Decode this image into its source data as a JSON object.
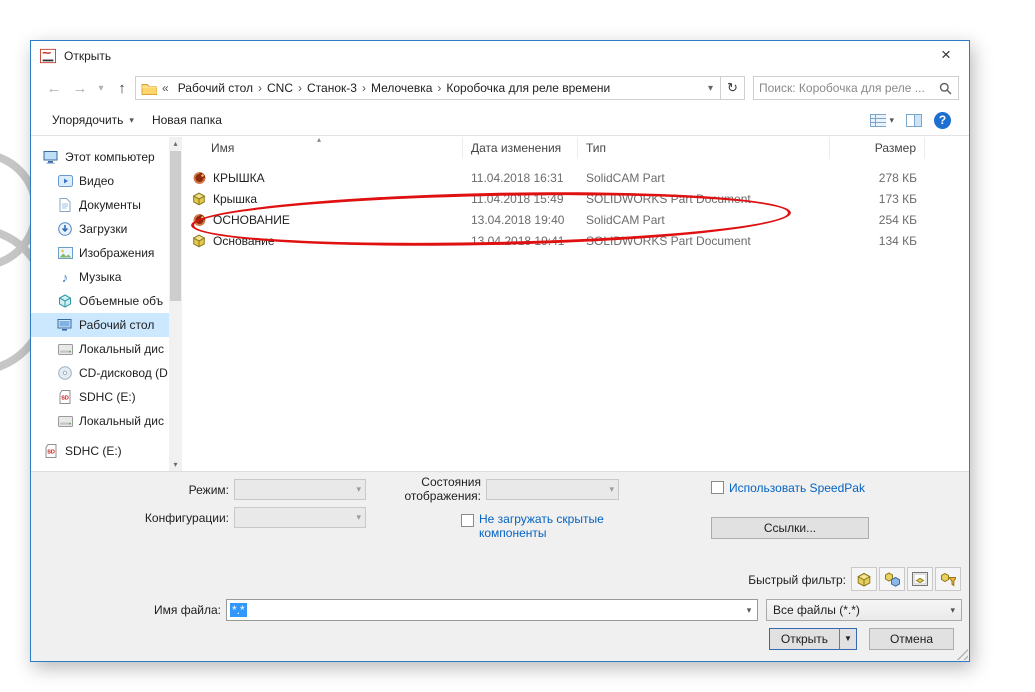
{
  "window": {
    "title": "Открыть",
    "close": "×"
  },
  "icons": {
    "back": "←",
    "forward": "→",
    "up": "↑",
    "dropdown": "▾",
    "refresh": "↻",
    "help": "?",
    "sort_asc": "▴",
    "scroll_up": "▴",
    "scroll_down": "▾",
    "menu_arrow": "▼",
    "crumb_sep": "›"
  },
  "address_bar": {
    "overflow_marker": "«",
    "breadcrumbs": [
      "Рабочий стол",
      "CNC",
      "Станок-3",
      "Мелочевка",
      "Коробочка для реле времени"
    ],
    "search_placeholder": "Поиск: Коробочка для реле ..."
  },
  "toolbar": {
    "organize_label": "Упорядочить",
    "new_folder_label": "Новая папка"
  },
  "sidebar": {
    "items": [
      {
        "id": "this-pc",
        "label": "Этот компьютер",
        "icon": "computer-icon",
        "level": 0
      },
      {
        "id": "video",
        "label": "Видео",
        "icon": "video-icon",
        "level": 1
      },
      {
        "id": "documents",
        "label": "Документы",
        "icon": "documents-icon",
        "level": 1
      },
      {
        "id": "downloads",
        "label": "Загрузки",
        "icon": "downloads-icon",
        "level": 1
      },
      {
        "id": "pictures",
        "label": "Изображения",
        "icon": "pictures-icon",
        "level": 1
      },
      {
        "id": "music",
        "label": "Музыка",
        "icon": "music-icon",
        "level": 1
      },
      {
        "id": "3d-objects",
        "label": "Объемные объ",
        "icon": "3d-objects-icon",
        "level": 1
      },
      {
        "id": "desktop",
        "label": "Рабочий стол",
        "icon": "desktop-icon",
        "level": 1,
        "selected": true
      },
      {
        "id": "local-disk",
        "label": "Локальный дис",
        "icon": "disk-icon",
        "level": 1
      },
      {
        "id": "cd-drive",
        "label": "CD-дисковод (D",
        "icon": "cd-icon",
        "level": 1
      },
      {
        "id": "sdhc-e",
        "label": "SDHC (E:)",
        "icon": "sd-icon",
        "level": 1
      },
      {
        "id": "local-disk-2",
        "label": "Локальный дис",
        "icon": "disk-icon",
        "level": 1
      },
      {
        "id": "sdhc-e-2",
        "label": "SDHC (E:)",
        "icon": "sd-icon",
        "level": 0,
        "gap_top": true
      }
    ]
  },
  "file_list": {
    "columns": [
      "Имя",
      "Дата изменения",
      "Тип",
      "Размер"
    ],
    "rows": [
      {
        "name": "КРЫШКА",
        "modified": "11.04.2018 16:31",
        "type": "SolidCAM Part",
        "size": "278 КБ",
        "icon": "solidcam-part-icon"
      },
      {
        "name": "Крышка",
        "modified": "11.04.2018 15:49",
        "type": "SOLIDWORKS Part Document",
        "size": "173 КБ",
        "icon": "solidworks-part-icon"
      },
      {
        "name": "ОСНОВАНИЕ",
        "modified": "13.04.2018 19:40",
        "type": "SolidCAM Part",
        "size": "254 КБ",
        "icon": "solidcam-part-icon",
        "annotated": true
      },
      {
        "name": "Основание",
        "modified": "13.04.2018 19:41",
        "type": "SOLIDWORKS Part Document",
        "size": "134 КБ",
        "icon": "solidworks-part-icon"
      }
    ]
  },
  "options": {
    "mode_label": "Режим:",
    "display_states_label": "Состояния отображения:",
    "configurations_label": "Конфигурации:",
    "speedpak_checkbox": "Использовать SpeedPak",
    "hidden_components_checkbox": "Не загружать скрытые компоненты",
    "references_button": "Ссылки...",
    "quick_filter_label": "Быстрый фильтр:"
  },
  "quick_filters": [
    {
      "name": "filter-parts-button",
      "icon": "part-filter-icon"
    },
    {
      "name": "filter-assemblies-button",
      "icon": "assembly-filter-icon"
    },
    {
      "name": "filter-drawings-button",
      "icon": "drawing-filter-icon"
    },
    {
      "name": "filter-top-level-button",
      "icon": "toplevel-filter-icon"
    }
  ],
  "footer": {
    "file_name_label": "Имя файла:",
    "file_name_value": "*.*",
    "file_type_value": "Все файлы (*.*)",
    "open_button": "Открыть",
    "cancel_button": "Отмена"
  },
  "colors": {
    "selection_highlight": "#cce8ff",
    "link_blue": "#0563c1",
    "annotation_red": "#e01010",
    "dialog_border": "#2f7cc4",
    "filename_selection": "#3297fd"
  }
}
